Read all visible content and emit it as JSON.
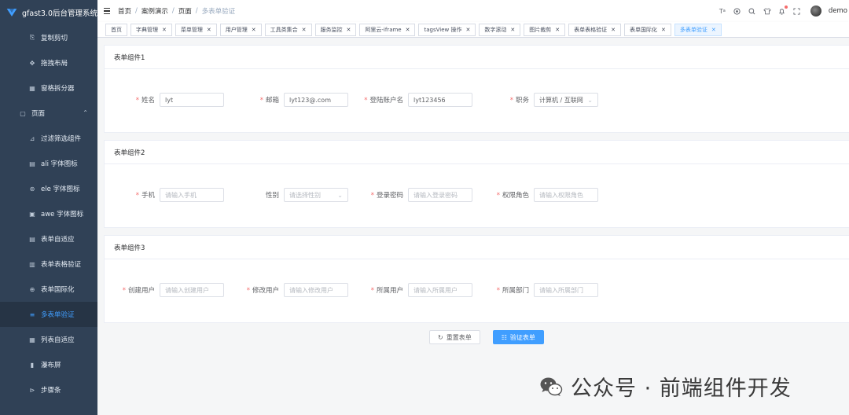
{
  "app": {
    "title": "gfast3.0后台管理系统"
  },
  "sidebar": {
    "items": [
      {
        "label": "复制剪切",
        "icon": "copy-icon",
        "glyph": "⎘"
      },
      {
        "label": "拖拽布局",
        "icon": "drag-icon",
        "glyph": "✥"
      },
      {
        "label": "窗格拆分器",
        "icon": "split-icon",
        "glyph": "▦"
      },
      {
        "label": "页面",
        "icon": "page-icon",
        "glyph": "▢",
        "parent": true,
        "expanded": true
      },
      {
        "label": "过滤筛选组件",
        "icon": "filter-icon",
        "glyph": "⊿"
      },
      {
        "label": "ali 字体图标",
        "icon": "font-icon",
        "glyph": "▤"
      },
      {
        "label": "ele 字体图标",
        "icon": "element-icon",
        "glyph": "⊛"
      },
      {
        "label": "awe 字体图标",
        "icon": "awesome-icon",
        "glyph": "▣"
      },
      {
        "label": "表单自适应",
        "icon": "form-icon",
        "glyph": "▤"
      },
      {
        "label": "表单表格验证",
        "icon": "table-icon",
        "glyph": "▥"
      },
      {
        "label": "表单国际化",
        "icon": "globe-icon",
        "glyph": "⊕"
      },
      {
        "label": "多表单验证",
        "icon": "multi-form-icon",
        "glyph": "≡",
        "active": true
      },
      {
        "label": "列表自适应",
        "icon": "list-icon",
        "glyph": "▦"
      },
      {
        "label": "瀑布屏",
        "icon": "waterfall-icon",
        "glyph": "▮"
      },
      {
        "label": "步骤条",
        "icon": "steps-icon",
        "glyph": "⊳"
      }
    ]
  },
  "breadcrumb": [
    "首页",
    "案例演示",
    "页面",
    "多表单验证"
  ],
  "header": {
    "user": "demo",
    "icons": [
      "translate-icon",
      "component-size-icon",
      "search-icon",
      "skin-icon",
      "bell-icon",
      "fullscreen-icon"
    ]
  },
  "tags": [
    {
      "label": "首页",
      "closable": false
    },
    {
      "label": "字典管理",
      "closable": true
    },
    {
      "label": "菜单管理",
      "closable": true
    },
    {
      "label": "用户管理",
      "closable": true
    },
    {
      "label": "工具类集合",
      "closable": true
    },
    {
      "label": "服务监控",
      "closable": true
    },
    {
      "label": "阿里云-iframe",
      "closable": true
    },
    {
      "label": "tagsView 操作",
      "closable": true
    },
    {
      "label": "数字滚动",
      "closable": true
    },
    {
      "label": "图片裁剪",
      "closable": true
    },
    {
      "label": "表单表格验证",
      "closable": true
    },
    {
      "label": "表单国际化",
      "closable": true
    },
    {
      "label": "多表单验证",
      "closable": true,
      "active": true
    }
  ],
  "forms": [
    {
      "title": "表单组件1",
      "fields": [
        {
          "label": "姓名",
          "required": true,
          "value": "lyt",
          "placeholder": ""
        },
        {
          "label": "邮箱",
          "required": true,
          "value": "lyt123@.com",
          "placeholder": ""
        },
        {
          "label": "登陆账户名",
          "required": true,
          "value": "lyt123456",
          "placeholder": ""
        },
        {
          "label": "职务",
          "required": true,
          "value": "计算机 / 互联网",
          "placeholder": "",
          "select": true
        }
      ]
    },
    {
      "title": "表单组件2",
      "fields": [
        {
          "label": "手机",
          "required": true,
          "value": "",
          "placeholder": "请输入手机"
        },
        {
          "label": "性别",
          "required": false,
          "value": "",
          "placeholder": "请选择性别",
          "select": true
        },
        {
          "label": "登录密码",
          "required": true,
          "value": "",
          "placeholder": "请输入登录密码"
        },
        {
          "label": "权限角色",
          "required": true,
          "value": "",
          "placeholder": "请输入权限角色"
        }
      ]
    },
    {
      "title": "表单组件3",
      "fields": [
        {
          "label": "创建用户",
          "required": true,
          "value": "",
          "placeholder": "请输入创建用户"
        },
        {
          "label": "修改用户",
          "required": true,
          "value": "",
          "placeholder": "请输入修改用户"
        },
        {
          "label": "所属用户",
          "required": true,
          "value": "",
          "placeholder": "请输入所属用户"
        },
        {
          "label": "所属部门",
          "required": true,
          "value": "",
          "placeholder": "请输入所属部门"
        }
      ]
    }
  ],
  "buttons": {
    "reset": "重置表单",
    "validate": "验证表单"
  },
  "footer": {
    "wechat_text": "公众号 · 前端组件开发"
  },
  "colors": {
    "sidebar_bg": "#304156",
    "primary": "#409eff",
    "required": "#f56c6c"
  }
}
